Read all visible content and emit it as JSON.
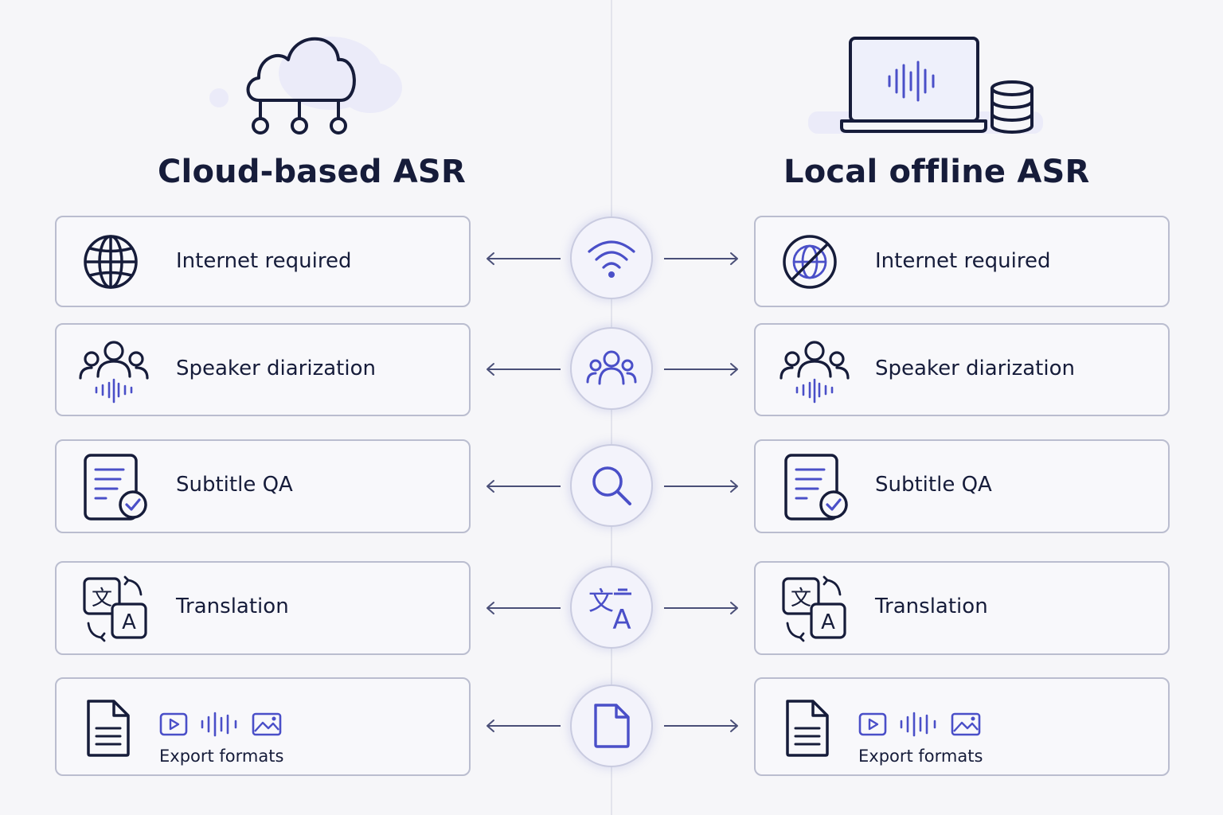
{
  "left_column": {
    "title": "Cloud-based ASR",
    "hero_icon": "cloud-network-icon",
    "features": [
      {
        "label": "Internet required",
        "icon": "globe-icon"
      },
      {
        "label": "Speaker diarization",
        "icon": "speaker-group-icon"
      },
      {
        "label": "Subtitle QA",
        "icon": "document-check-icon"
      },
      {
        "label": "Translation",
        "icon": "translate-icon"
      },
      {
        "label": "Export formats",
        "icon": "document-icon"
      }
    ]
  },
  "right_column": {
    "title": "Local offline ASR",
    "hero_icon": "laptop-database-icon",
    "features": [
      {
        "label": "Internet required",
        "icon": "no-globe-icon"
      },
      {
        "label": "Speaker diarization",
        "icon": "speaker-group-icon"
      },
      {
        "label": "Subtitle QA",
        "icon": "document-check-icon"
      },
      {
        "label": "Translation",
        "icon": "translate-icon"
      },
      {
        "label": "Export formats",
        "icon": "document-icon"
      }
    ]
  },
  "center_hubs": [
    "wifi-icon",
    "people-icon",
    "search-icon",
    "translate-icon",
    "file-icon"
  ],
  "export_format_icons": [
    "video-icon",
    "waveform-icon",
    "image-icon"
  ],
  "colors": {
    "ink": "#161c3a",
    "accent": "#4a4fc8",
    "card_border": "#babdcf",
    "background": "#f6f6f9",
    "hub_fill": "#f3f3fb"
  }
}
